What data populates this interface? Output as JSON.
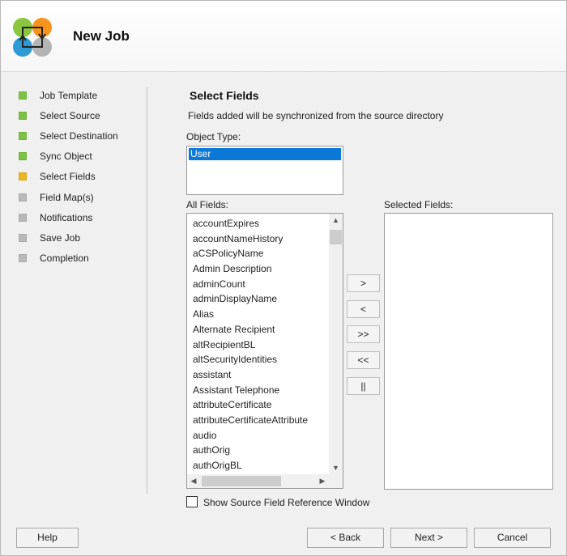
{
  "header": {
    "title": "New Job",
    "logo_icon": "sync-arrows-logo-icon"
  },
  "nav": {
    "items": [
      {
        "label": "Job Template",
        "state": "done",
        "color": "#7cc242"
      },
      {
        "label": "Select Source",
        "state": "done",
        "color": "#7cc242"
      },
      {
        "label": "Select Destination",
        "state": "done",
        "color": "#7cc242"
      },
      {
        "label": "Sync Object",
        "state": "done",
        "color": "#7cc242"
      },
      {
        "label": "Select Fields",
        "state": "current",
        "color": "#e8b81e"
      },
      {
        "label": "Field Map(s)",
        "state": "pending",
        "color": "#b9b9b9"
      },
      {
        "label": "Notifications",
        "state": "pending",
        "color": "#b9b9b9"
      },
      {
        "label": "Save Job",
        "state": "pending",
        "color": "#b9b9b9"
      },
      {
        "label": "Completion",
        "state": "pending",
        "color": "#b9b9b9"
      }
    ]
  },
  "main": {
    "title": "Select Fields",
    "description": "Fields added will be synchronized from the source directory",
    "object_type_label": "Object Type:",
    "object_types": [
      "User"
    ],
    "selected_object_type": "User",
    "all_fields_label": "All Fields:",
    "selected_fields_label": "Selected Fields:",
    "all_fields": [
      "accountExpires",
      "accountNameHistory",
      "aCSPolicyName",
      "Admin Description",
      "adminCount",
      "adminDisplayName",
      "Alias",
      "Alternate Recipient",
      "altRecipientBL",
      "altSecurityIdentities",
      "assistant",
      "Assistant Telephone",
      "attributeCertificate",
      "attributeCertificateAttribute",
      "audio",
      "authOrig",
      "authOrigBL"
    ],
    "selected_fields": [],
    "move_buttons": {
      "add": ">",
      "remove": "<",
      "add_all": ">>",
      "remove_all": "<<",
      "reorder": "||"
    },
    "show_reference_label": "Show Source Field Reference Window",
    "show_reference_checked": false
  },
  "footer": {
    "help": "Help",
    "back": "< Back",
    "next": "Next >",
    "cancel": "Cancel"
  },
  "colors": {
    "selection": "#0a78d7"
  }
}
